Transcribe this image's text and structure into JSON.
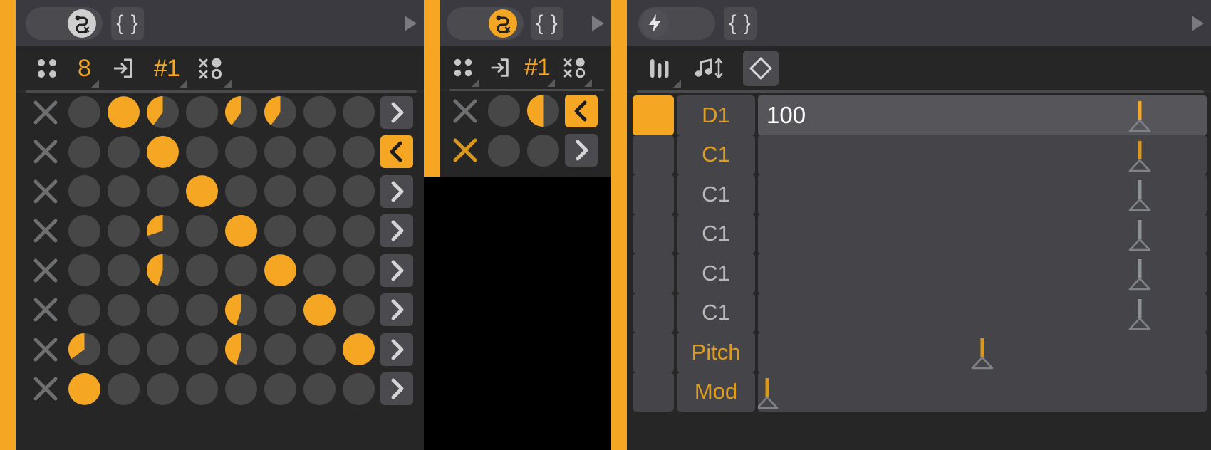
{
  "panels": {
    "sequencer": {
      "header": {
        "toggle_icon": "snake-path-x-icon",
        "toggle_state": "off",
        "braces_label": "{ }",
        "play_icon": "play-triangle-icon"
      },
      "toolbar": {
        "items": [
          {
            "icon": "four-dots-icon",
            "label": ""
          },
          {
            "icon": "",
            "label": "8"
          },
          {
            "icon": "enter-arrow-icon",
            "label": ""
          },
          {
            "icon": "",
            "label": "#1"
          },
          {
            "icon": "x-o-grid-icon",
            "label": ""
          }
        ]
      },
      "rows": [
        {
          "clear_icon": "x-icon",
          "clear_active": false,
          "steps": [
            0,
            1,
            0.4,
            0,
            0.4,
            0.4,
            0,
            0
          ],
          "arrow": ">",
          "arrow_selected": false
        },
        {
          "clear_icon": "x-icon",
          "clear_active": false,
          "steps": [
            0,
            0,
            1,
            0,
            0,
            0,
            0,
            0
          ],
          "arrow": "<",
          "arrow_selected": true
        },
        {
          "clear_icon": "x-icon",
          "clear_active": false,
          "steps": [
            0,
            0,
            0,
            1,
            0,
            0,
            0,
            0
          ],
          "arrow": ">",
          "arrow_selected": false
        },
        {
          "clear_icon": "x-icon",
          "clear_active": false,
          "steps": [
            0,
            0,
            0.3,
            0,
            1,
            0,
            0,
            0
          ],
          "arrow": ">",
          "arrow_selected": false
        },
        {
          "clear_icon": "x-icon",
          "clear_active": false,
          "steps": [
            0,
            0,
            0.45,
            0,
            0,
            1,
            0,
            0
          ],
          "arrow": ">",
          "arrow_selected": false
        },
        {
          "clear_icon": "x-icon",
          "clear_active": false,
          "steps": [
            0,
            0,
            0,
            0,
            0.45,
            0,
            1,
            0
          ],
          "arrow": ">",
          "arrow_selected": false
        },
        {
          "clear_icon": "x-icon",
          "clear_active": false,
          "steps": [
            0.35,
            0,
            0,
            0,
            0.45,
            0,
            0,
            1
          ],
          "arrow": ">",
          "arrow_selected": false
        },
        {
          "clear_icon": "x-icon",
          "clear_active": false,
          "steps": [
            1,
            0,
            0,
            0,
            0,
            0,
            0,
            0
          ],
          "arrow": ">",
          "arrow_selected": false
        }
      ]
    },
    "mini_sequencer": {
      "header": {
        "toggle_icon": "snake-path-x-icon",
        "toggle_state": "on",
        "braces_label": "{ }",
        "play_icon": "play-triangle-icon"
      },
      "toolbar": {
        "items": [
          {
            "icon": "four-dots-icon",
            "label": ""
          },
          {
            "icon": "enter-arrow-icon",
            "label": ""
          },
          {
            "icon": "",
            "label": "#1"
          },
          {
            "icon": "x-o-grid-icon",
            "label": ""
          }
        ]
      },
      "rows": [
        {
          "clear_icon": "x-icon",
          "clear_active": false,
          "steps": [
            0,
            0.5
          ],
          "arrow": "<",
          "arrow_selected": true
        },
        {
          "clear_icon": "x-icon",
          "clear_active": true,
          "steps": [
            0,
            0
          ],
          "arrow": ">",
          "arrow_selected": false
        }
      ]
    },
    "note_editor": {
      "header": {
        "toggle_icon": "lightning-bolt-icon",
        "toggle_state": "off",
        "braces_label": "{ }",
        "play_icon": "play-triangle-icon"
      },
      "toolbar": {
        "items": [
          {
            "icon": "faders-icon",
            "label": ""
          },
          {
            "icon": "note-updown-icon",
            "label": ""
          },
          {
            "icon": "diamond-icon",
            "label": "",
            "boxed": true
          }
        ]
      },
      "rows": [
        {
          "swatch_active": true,
          "note": "D1",
          "note_accent": true,
          "value": "100",
          "row_lit": true,
          "slider_pct": 85,
          "stem_tone": "bright"
        },
        {
          "swatch_active": false,
          "note": "C1",
          "note_accent": true,
          "value": "",
          "row_lit": false,
          "slider_pct": 85,
          "stem_tone": "normal"
        },
        {
          "swatch_active": false,
          "note": "C1",
          "note_accent": false,
          "value": "",
          "row_lit": false,
          "slider_pct": 85,
          "stem_tone": "dim"
        },
        {
          "swatch_active": false,
          "note": "C1",
          "note_accent": false,
          "value": "",
          "row_lit": false,
          "slider_pct": 85,
          "stem_tone": "dim"
        },
        {
          "swatch_active": false,
          "note": "C1",
          "note_accent": false,
          "value": "",
          "row_lit": false,
          "slider_pct": 85,
          "stem_tone": "dim"
        },
        {
          "swatch_active": false,
          "note": "C1",
          "note_accent": false,
          "value": "",
          "row_lit": false,
          "slider_pct": 85,
          "stem_tone": "dim"
        },
        {
          "swatch_active": false,
          "note": "Pitch",
          "note_accent": true,
          "value": "",
          "row_lit": false,
          "slider_pct": 50,
          "stem_tone": "normal"
        },
        {
          "swatch_active": false,
          "note": "Mod",
          "note_accent": true,
          "value": "",
          "row_lit": false,
          "slider_pct": 2,
          "stem_tone": "normal"
        }
      ]
    }
  },
  "colors": {
    "accent": "#f5a623",
    "accent_dim": "#d9981b",
    "panel_bg": "#2b2b2b",
    "grid_bg": "#262626",
    "header_bg": "#3a3a40",
    "control_bg": "#4a4a4f",
    "dot_off": "#474747",
    "text_muted": "#b9b9b9"
  }
}
